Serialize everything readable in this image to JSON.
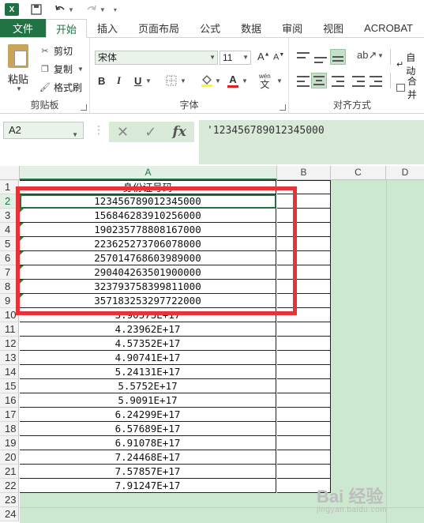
{
  "qat": {
    "app_icon_label": "X",
    "save_icon": "save-icon",
    "undo_icon": "undo-icon",
    "redo_icon": "redo-icon"
  },
  "tabs": [
    {
      "label": "文件"
    },
    {
      "label": "开始"
    },
    {
      "label": "插入"
    },
    {
      "label": "页面布局"
    },
    {
      "label": "公式"
    },
    {
      "label": "数据"
    },
    {
      "label": "审阅"
    },
    {
      "label": "视图"
    },
    {
      "label": "ACROBAT"
    }
  ],
  "ribbon": {
    "clipboard": {
      "paste": "粘贴",
      "cut": "剪切",
      "copy": "复制",
      "format_painter": "格式刷",
      "group": "剪贴板"
    },
    "font": {
      "name": "宋体",
      "size": "11",
      "bold": "B",
      "italic": "I",
      "underline": "U",
      "inc": "A",
      "dec": "A",
      "group": "字体",
      "wen": "wén",
      "wen_char": "文"
    },
    "alignment": {
      "group": "对齐方式",
      "wrap": "自动",
      "merge": "合并"
    }
  },
  "formula_bar": {
    "name_box": "A2",
    "cancel": "✕",
    "enter": "✓",
    "fx": "fx",
    "content": "'123456789012345000"
  },
  "grid": {
    "columns": [
      "A",
      "B",
      "C",
      "D"
    ],
    "header_cell": "身份证号码",
    "rows": [
      {
        "n": "1",
        "a": "身份证号码"
      },
      {
        "n": "2",
        "a": "123456789012345000",
        "tri": true
      },
      {
        "n": "3",
        "a": "156846283910256000",
        "tri": true
      },
      {
        "n": "4",
        "a": "190235778808167000",
        "tri": true
      },
      {
        "n": "5",
        "a": "223625273706078000",
        "tri": true
      },
      {
        "n": "6",
        "a": "257014768603989000",
        "tri": true
      },
      {
        "n": "7",
        "a": "290404263501900000",
        "tri": true
      },
      {
        "n": "8",
        "a": "323793758399811000",
        "tri": true
      },
      {
        "n": "9",
        "a": "357183253297722000",
        "tri": true
      },
      {
        "n": "10",
        "a": "3.90573E+17"
      },
      {
        "n": "11",
        "a": "4.23962E+17"
      },
      {
        "n": "12",
        "a": "4.57352E+17"
      },
      {
        "n": "13",
        "a": "4.90741E+17"
      },
      {
        "n": "14",
        "a": "5.24131E+17"
      },
      {
        "n": "15",
        "a": "5.5752E+17"
      },
      {
        "n": "16",
        "a": "5.9091E+17"
      },
      {
        "n": "17",
        "a": "6.24299E+17"
      },
      {
        "n": "18",
        "a": "6.57689E+17"
      },
      {
        "n": "19",
        "a": "6.91078E+17"
      },
      {
        "n": "20",
        "a": "7.24468E+17"
      },
      {
        "n": "21",
        "a": "7.57857E+17"
      },
      {
        "n": "22",
        "a": "7.91247E+17"
      },
      {
        "n": "23",
        "a": ""
      },
      {
        "n": "24",
        "a": ""
      }
    ]
  },
  "watermark": {
    "main": "Bai 经验",
    "sub": "jingyan.baidu.com"
  },
  "colors": {
    "accent": "#217346",
    "highlight": "#e8323a",
    "fill": "#cde8d0"
  }
}
